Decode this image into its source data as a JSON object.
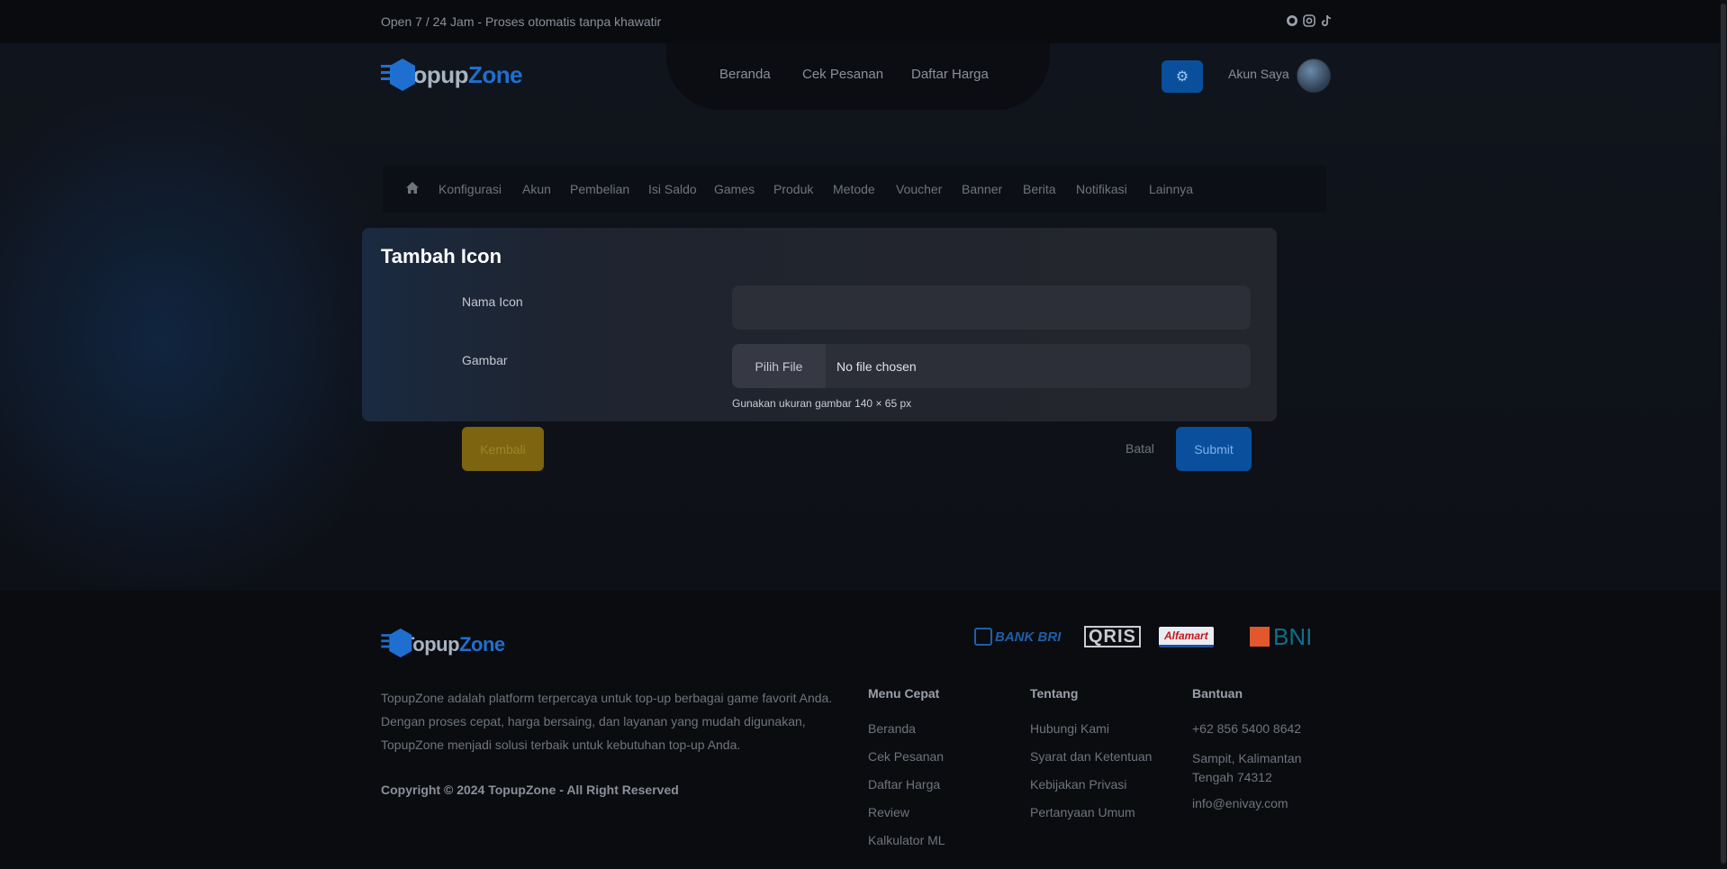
{
  "topbar": {
    "text": "Open 7 / 24 Jam - Proses otomatis tanpa khawatir",
    "social_icons": [
      "whatsapp-icon",
      "instagram-icon",
      "tiktok-icon"
    ]
  },
  "brand": {
    "name_part1": "Topup",
    "name_part2": "Zone",
    "accent_color": "#1f6fd1"
  },
  "nav": {
    "links": [
      "Beranda",
      "Cek Pesanan",
      "Daftar Harga"
    ]
  },
  "header": {
    "account_label": "Akun Saya"
  },
  "admin_menu": {
    "items": [
      "Konfigurasi",
      "Akun",
      "Pembelian",
      "Isi Saldo",
      "Games",
      "Produk",
      "Metode",
      "Voucher",
      "Banner",
      "Berita",
      "Notifikasi",
      "Lainnya"
    ]
  },
  "form": {
    "title": "Tambah Icon",
    "name_label": "Nama Icon",
    "name_value": "",
    "image_label": "Gambar",
    "file_button": "Pilih File",
    "file_status": "No file chosen",
    "hint": "Gunakan ukuran gambar 140 × 65 px",
    "back_label": "Kembali",
    "cancel_label": "Batal",
    "submit_label": "Submit"
  },
  "footer": {
    "about": "TopupZone adalah platform terpercaya untuk top-up berbagai game favorit Anda. Dengan proses cepat, harga bersaing, dan layanan yang mudah digunakan, TopupZone menjadi solusi terbaik untuk kebutuhan top-up Anda.",
    "copyright": "Copyright © 2024 TopupZone - All Right Reserved",
    "payment_logos": [
      "BANK BRI",
      "QRIS",
      "Alfamart",
      "BNI"
    ],
    "columns": [
      {
        "title": "Menu Cepat",
        "links": [
          "Beranda",
          "Cek Pesanan",
          "Daftar Harga",
          "Review",
          "Kalkulator ML"
        ]
      },
      {
        "title": "Tentang",
        "links": [
          "Hubungi Kami",
          "Syarat dan Ketentuan",
          "Kebijakan Privasi",
          "Pertanyaan Umum"
        ]
      },
      {
        "title": "Bantuan",
        "links": [
          "+62 856 5400 8642",
          "Sampit, Kalimantan Tengah 74312",
          "info@enivay.com"
        ]
      }
    ]
  }
}
